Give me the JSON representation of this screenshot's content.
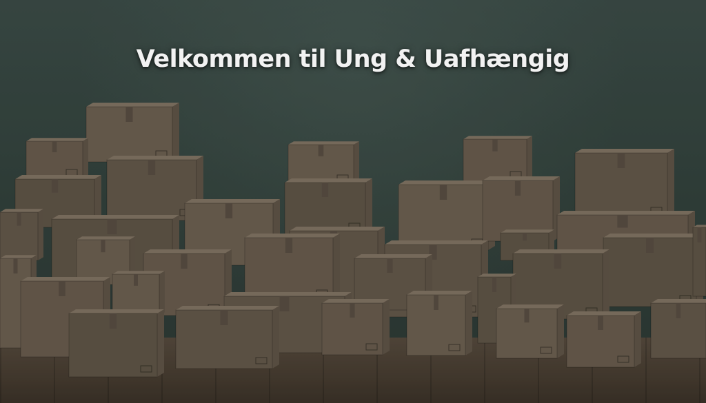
{
  "hero": {
    "title": "Velkommen til Ung & Uafhængig"
  },
  "colors": {
    "wall": "#3d4e4a",
    "box_face": "#7a6a5a",
    "box_top": "#8a7a69",
    "box_side": "#65574a",
    "tape": "#5d5045",
    "floor": "#4a3d31",
    "title_text": "#f2f2f2"
  },
  "scene": {
    "description_icon": "cardboard-boxes-image"
  }
}
